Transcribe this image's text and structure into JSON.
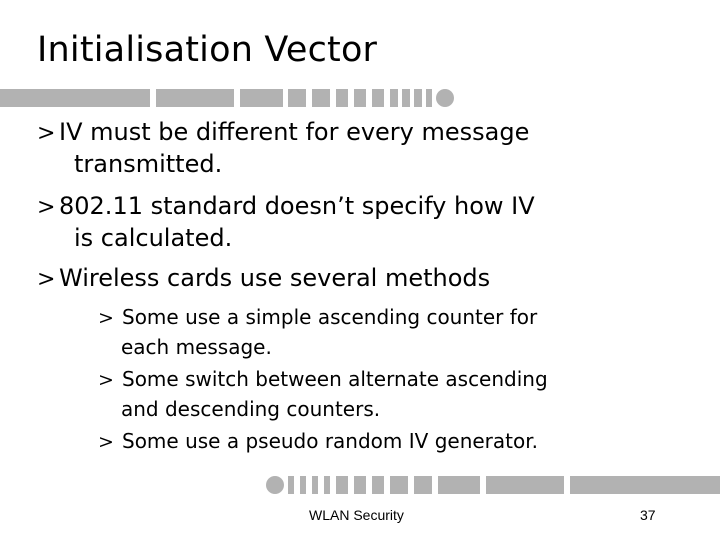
{
  "slide": {
    "title": "Initialisation Vector",
    "bullets": [
      {
        "marker": ">",
        "lines": [
          "IV must be different for every message",
          "transmitted."
        ]
      },
      {
        "marker": ">",
        "lines": [
          "802.11 standard doesn’t specify how IV",
          "is calculated."
        ]
      },
      {
        "marker": ">",
        "lines": [
          "Wireless cards use several methods"
        ]
      }
    ],
    "sub_bullets": [
      {
        "marker": ">",
        "lines": [
          "Some use a simple ascending counter for",
          "each message."
        ]
      },
      {
        "marker": ">",
        "lines": [
          "Some switch between alternate ascending",
          "and descending counters."
        ]
      },
      {
        "marker": ">",
        "lines": [
          "Some use a pseudo random IV generator."
        ]
      }
    ]
  },
  "footer": {
    "center_text": "WLAN Security",
    "page_number": "37"
  },
  "decoration": {
    "bar_color": "#b2b2b2"
  }
}
